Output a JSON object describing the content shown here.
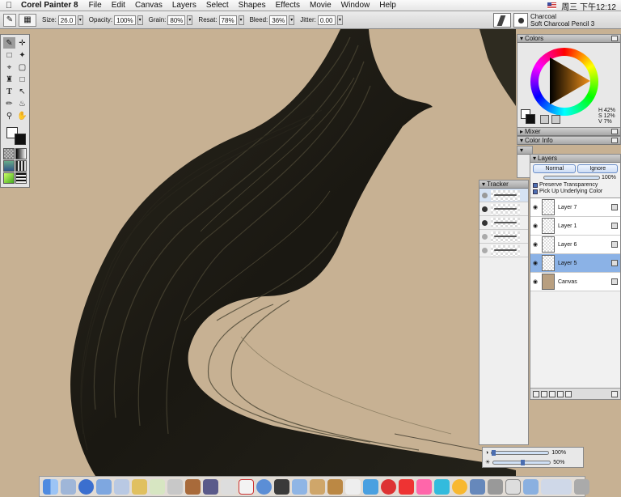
{
  "menubar": {
    "app_name": "Corel Painter 8",
    "items": [
      "File",
      "Edit",
      "Canvas",
      "Layers",
      "Select",
      "Shapes",
      "Effects",
      "Movie",
      "Window",
      "Help"
    ],
    "clock": "周三 下午12:12"
  },
  "property_bar": {
    "size_label": "Size:",
    "size_value": "26.0",
    "opacity_label": "Opacity:",
    "opacity_value": "100%",
    "grain_label": "Grain:",
    "grain_value": "80%",
    "resat_label": "Resat:",
    "resat_value": "78%",
    "bleed_label": "Bleed:",
    "bleed_value": "36%",
    "jitter_label": "Jitter:",
    "jitter_value": "0.00"
  },
  "brush_selector": {
    "category": "Charcoal",
    "variant": "Soft Charcoal Pencil 3"
  },
  "colors_panel": {
    "title": "Colors",
    "hsv": [
      "H 42%",
      "S 12%",
      "V 7%"
    ],
    "hue_color": "#f09018"
  },
  "mixer_panel": {
    "title": "Mixer"
  },
  "color_info_panel": {
    "title": "Color Info"
  },
  "tracker_panel": {
    "title": "Tracker"
  },
  "layers_panel": {
    "title": "Layers",
    "composite_method": "Normal",
    "composite_depth": "Ignore",
    "opacity": "100%",
    "preserve_transparency": "Preserve Transparency",
    "pick_up_underlying": "Pick Up Underlying Color",
    "layers": [
      {
        "name": "Layer 7",
        "selected": false
      },
      {
        "name": "Layer 1",
        "selected": false
      },
      {
        "name": "Layer 6",
        "selected": false
      },
      {
        "name": "Layer 5",
        "selected": true
      },
      {
        "name": "Canvas",
        "selected": false
      }
    ]
  },
  "bottom_sliders": {
    "top_value": "100%",
    "bottom_value": "50%"
  },
  "canvas": {
    "background_color": "#c7b193",
    "paint_color": "#1c1a14"
  },
  "dock": {
    "icons": [
      "finder-icon",
      "mail-icon",
      "ie-icon",
      "itunes-icon",
      "search-icon",
      "text-icon",
      "music-icon",
      "disk-icon",
      "photo-icon",
      "movie-icon",
      "mail2-icon",
      "ical-icon",
      "safari-icon",
      "dvd-icon",
      "iphoto-icon",
      "painter-icon",
      "app-icon",
      "app2-icon",
      "app3-icon",
      "app4-icon",
      "app5-icon",
      "app6-icon",
      "app7-icon",
      "app8-icon",
      "app9-icon",
      "app10-icon",
      "app11-icon",
      "folder-icon",
      "keyboard-icon",
      "trash-icon"
    ]
  }
}
